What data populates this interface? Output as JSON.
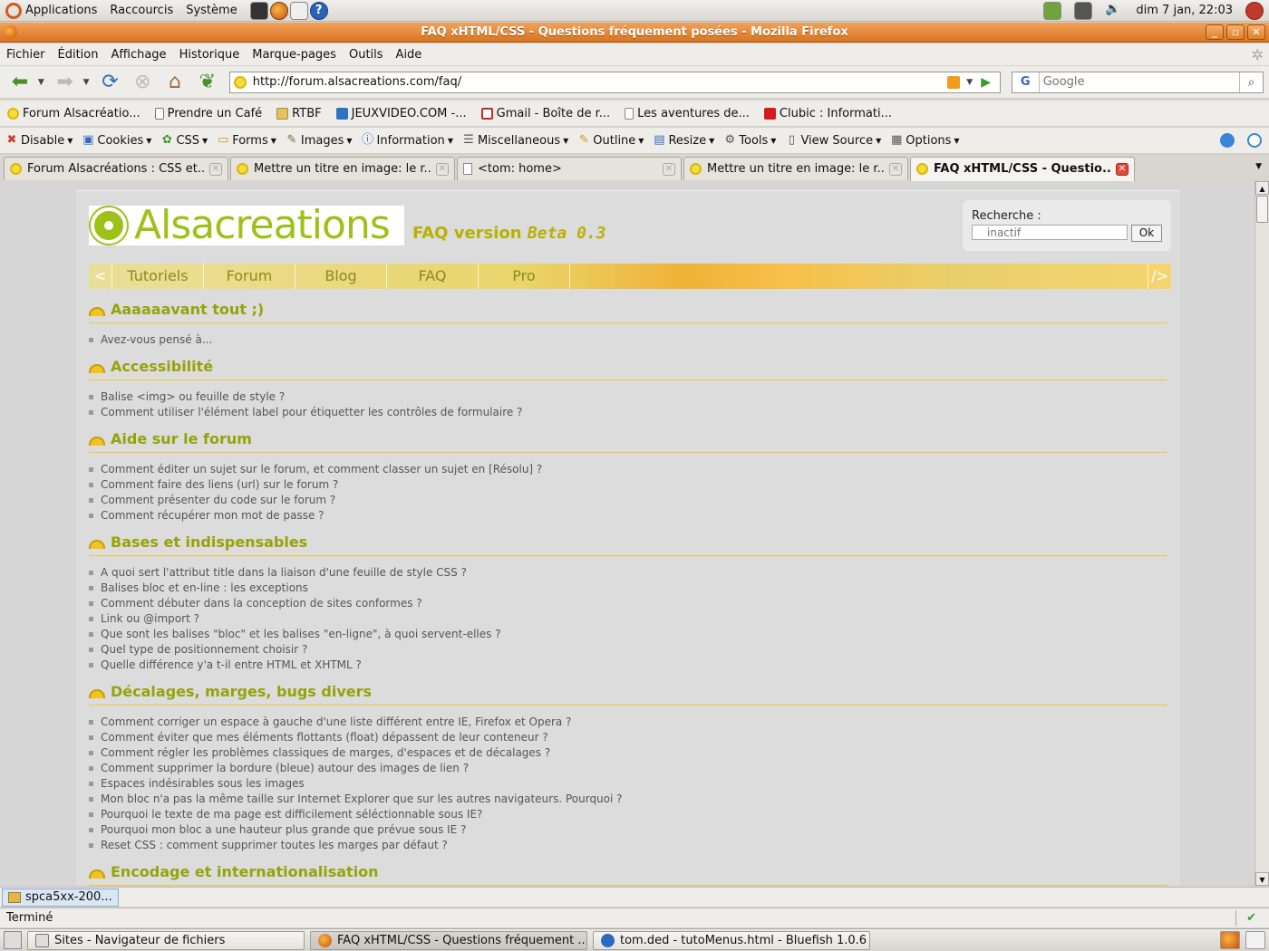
{
  "top_panel": {
    "menus": [
      "Applications",
      "Raccourcis",
      "Système"
    ],
    "clock": "dim  7 jan, 22:03"
  },
  "window": {
    "title": "FAQ xHTML/CSS - Questions fréquement posées - Mozilla Firefox"
  },
  "menubar": [
    "Fichier",
    "Édition",
    "Affichage",
    "Historique",
    "Marque-pages",
    "Outils",
    "Aide"
  ],
  "navbar": {
    "url": "http://forum.alsacreations.com/faq/",
    "search_engine": "G",
    "search_placeholder": "Google"
  },
  "bookmarks": [
    {
      "label": "Forum Alsacréatio...",
      "icon": "sun"
    },
    {
      "label": "Prendre un Café",
      "icon": "cup"
    },
    {
      "label": "RTBF",
      "icon": "folder"
    },
    {
      "label": "JEUXVIDEO.COM -...",
      "icon": "jv"
    },
    {
      "label": "Gmail - Boîte de r...",
      "icon": "gm"
    },
    {
      "label": "Les aventures de...",
      "icon": "page"
    },
    {
      "label": "Clubic : Informati...",
      "icon": "clubic"
    }
  ],
  "devbar": [
    {
      "label": "Disable",
      "icon": "✖",
      "color": "#d63a2a"
    },
    {
      "label": "Cookies",
      "icon": "▣",
      "color": "#3466c2"
    },
    {
      "label": "CSS",
      "icon": "✿",
      "color": "#3a9c27"
    },
    {
      "label": "Forms",
      "icon": "▭",
      "color": "#c99a1a"
    },
    {
      "label": "Images",
      "icon": "✎",
      "color": "#7a6a3a"
    },
    {
      "label": "Information",
      "icon": "ⓘ",
      "color": "#3466c2"
    },
    {
      "label": "Miscellaneous",
      "icon": "☰",
      "color": "#555555"
    },
    {
      "label": "Outline",
      "icon": "✎",
      "color": "#c99a1a"
    },
    {
      "label": "Resize",
      "icon": "▤",
      "color": "#3466c2"
    },
    {
      "label": "Tools",
      "icon": "⚙",
      "color": "#555555"
    },
    {
      "label": "View Source",
      "icon": "▯",
      "color": "#555555"
    },
    {
      "label": "Options",
      "icon": "▦",
      "color": "#555555"
    }
  ],
  "tabs": [
    {
      "label": "Forum Alsacréations : CSS et...",
      "icon": "sun",
      "active": false
    },
    {
      "label": "Mettre un titre en image: le r...",
      "icon": "sun",
      "active": false
    },
    {
      "label": "<tom: home>",
      "icon": "page",
      "active": false
    },
    {
      "label": "Mettre un titre en image: le r...",
      "icon": "sun",
      "active": false
    },
    {
      "label": "FAQ xHTML/CSS - Questio...",
      "icon": "sun",
      "active": true
    }
  ],
  "site": {
    "brand": "Alsacreations",
    "faq_version_prefix": "FAQ version",
    "faq_version_beta": "Beta 0.3",
    "search_label": "Recherche :",
    "search_placeholder": "inactif",
    "search_button": "Ok",
    "nav": [
      "Tutoriels",
      "Forum",
      "Blog",
      "FAQ",
      "Pro"
    ],
    "nav_prev": "<",
    "nav_next": "/>"
  },
  "faq_sections": [
    {
      "title": "Aaaaaavant tout ;)",
      "items": [
        "Avez-vous pensé à..."
      ]
    },
    {
      "title": "Accessibilité",
      "items": [
        "Balise <img> ou feuille de style ?",
        "Comment utiliser l'élément label pour étiquetter les contrôles de formulaire ?"
      ]
    },
    {
      "title": "Aide sur le forum",
      "items": [
        "Comment éditer un sujet sur le forum, et comment classer un sujet en [Résolu] ?",
        "Comment faire des liens (url) sur le forum ?",
        "Comment présenter du code sur le forum ?",
        "Comment récupérer mon mot de passe ?"
      ]
    },
    {
      "title": "Bases et indispensables",
      "items": [
        "A quoi sert l'attribut title dans la liaison d'une feuille de style CSS ?",
        "Balises bloc et en-line : les exceptions",
        "Comment débuter dans la conception de sites conformes ?",
        "Link ou @import ?",
        "Que sont les balises \"bloc\" et les balises \"en-ligne\", à quoi servent-elles ?",
        "Quel type de positionnement choisir ?",
        "Quelle différence y'a t-il entre HTML et XHTML ?"
      ]
    },
    {
      "title": "Décalages, marges, bugs divers",
      "items": [
        "Comment corriger un espace à gauche d'une liste différent entre IE, Firefox et Opera ?",
        "Comment éviter que mes éléments flottants (float) dépassent de leur conteneur ?",
        "Comment régler les problèmes classiques de marges, d'espaces et de décalages ?",
        "Comment supprimer la bordure (bleue) autour des images de lien ?",
        "Espaces indésirables sous les images",
        "Mon bloc n'a pas la même taille sur Internet Explorer que sur les autres navigateurs. Pourquoi ?",
        "Pourquoi le texte de ma page est difficilement séléctionnable sous IE?",
        "Pourquoi mon bloc a une hauteur plus grande que prévue sous IE ?",
        "Reset CSS : comment supprimer toutes les marges par défaut ?"
      ]
    },
    {
      "title": "Encodage et internationalisation",
      "items": []
    }
  ],
  "download_bar": {
    "item": "spca5xx-200..."
  },
  "statusbar": {
    "text": "Terminé"
  },
  "taskbar": [
    {
      "label": "Sites - Navigateur de fichiers",
      "icon": "files",
      "active": false
    },
    {
      "label": "FAQ xHTML/CSS - Questions fréquement ...",
      "icon": "ff",
      "active": true
    },
    {
      "label": "tom.ded - tutoMenus.html - Bluefish 1.0.6",
      "icon": "bf",
      "active": false
    }
  ]
}
